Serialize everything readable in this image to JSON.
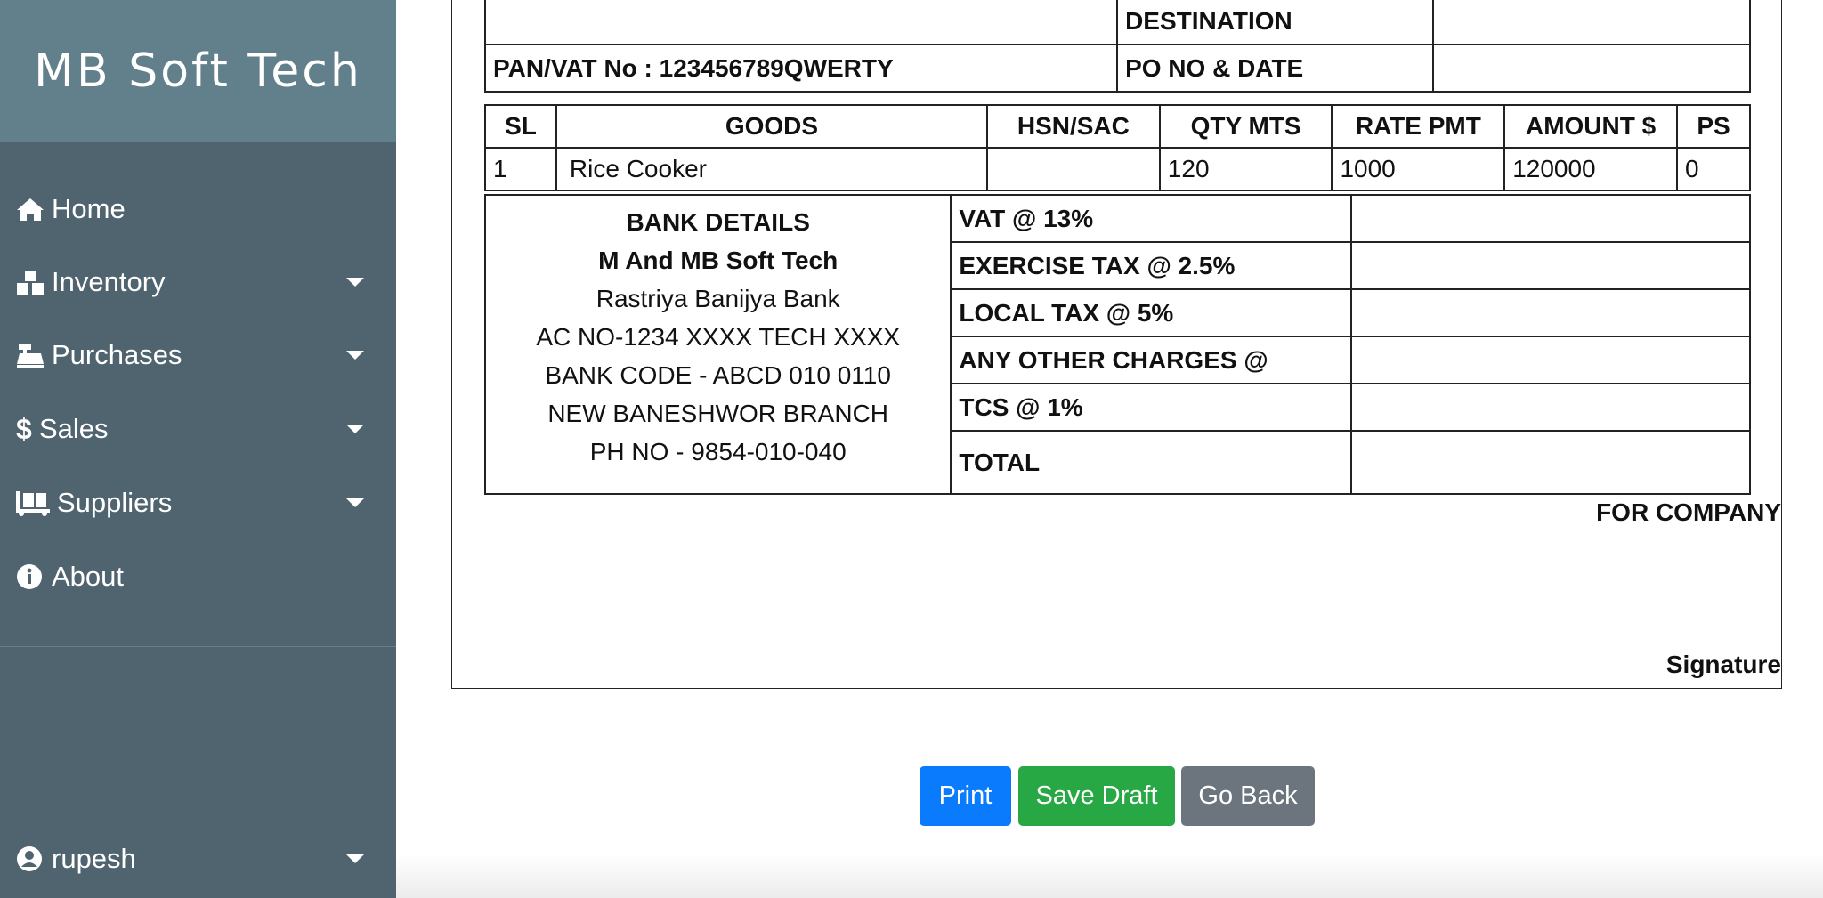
{
  "sidebar": {
    "brand": "MB Soft Tech",
    "items": [
      {
        "label": "Home",
        "icon": "home-icon",
        "dropdown": false
      },
      {
        "label": "Inventory",
        "icon": "boxes-icon",
        "dropdown": true
      },
      {
        "label": "Purchases",
        "icon": "cash-register-icon",
        "dropdown": true
      },
      {
        "label": "Sales",
        "icon": "dollar-icon",
        "dropdown": true
      },
      {
        "label": "Suppliers",
        "icon": "dolly-icon",
        "dropdown": true
      },
      {
        "label": "About",
        "icon": "info-icon",
        "dropdown": false
      }
    ],
    "user": {
      "label": "rupesh",
      "icon": "user-circle-icon"
    }
  },
  "invoice": {
    "destination_label": "DESTINATION",
    "pan_vat": "PAN/VAT No : 123456789QWERTY",
    "po_label": "PO NO & DATE",
    "items_headers": [
      "SL",
      "GOODS",
      "HSN/SAC",
      "QTY MTS",
      "RATE PMT",
      "AMOUNT $",
      "PS"
    ],
    "items": [
      {
        "sl": "1",
        "goods": "Rice Cooker",
        "hsn": "",
        "qty": "120",
        "rate": "1000",
        "amount": "120000",
        "ps": "0"
      }
    ],
    "bank": {
      "heading": "BANK DETAILS",
      "name": "M And MB Soft Tech",
      "bank_name": "Rastriya Banijya Bank",
      "account": "AC NO-1234 XXXX TECH XXXX",
      "code": "BANK CODE - ABCD 010 0110",
      "branch": "NEW BANESHWOR BRANCH",
      "phone": "PH NO - 9854-010-040"
    },
    "taxes": [
      {
        "label": "VAT @ 13%",
        "value": ""
      },
      {
        "label": "EXERCISE TAX @ 2.5%",
        "value": ""
      },
      {
        "label": "LOCAL TAX @ 5%",
        "value": ""
      },
      {
        "label": "ANY OTHER CHARGES @",
        "value": ""
      },
      {
        "label": "TCS @ 1%",
        "value": ""
      },
      {
        "label": "TOTAL",
        "value": ""
      }
    ],
    "for_company": "FOR COMPANY",
    "signature": "Signature"
  },
  "actions": {
    "print": "Print",
    "save_draft": "Save Draft",
    "go_back": "Go Back"
  },
  "colors": {
    "sidebar_bg": "#4f646f",
    "brand_bg": "#62808c",
    "print": "#0a7bfc",
    "save": "#28a745",
    "back": "#6c757d"
  }
}
